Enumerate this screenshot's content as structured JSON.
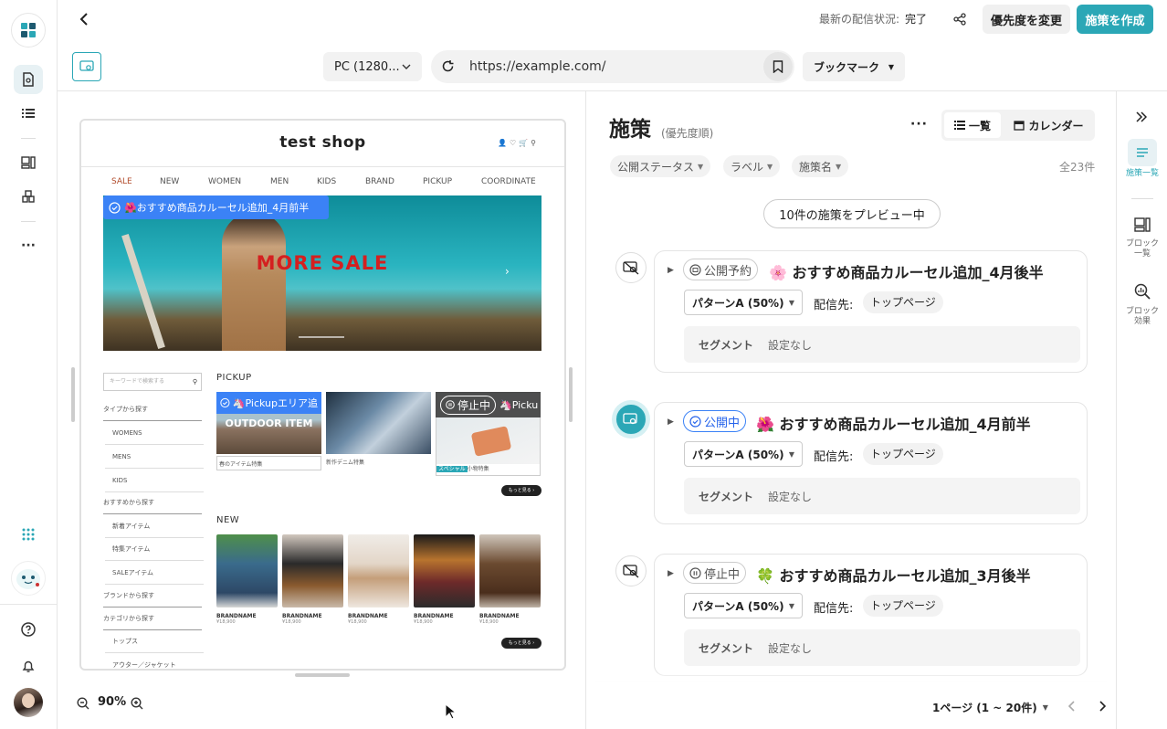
{
  "header": {
    "status_label": "最新の配信状況:",
    "status_value": "完了",
    "priority_button": "優先度を変更",
    "create_button": "施策を作成"
  },
  "toolbar": {
    "device": "PC (1280...",
    "url": "https://example.com/",
    "bookmark_button": "ブックマーク"
  },
  "preview": {
    "shop_title": "test shop",
    "nav": [
      "SALE",
      "NEW",
      "WOMEN",
      "MEN",
      "KIDS",
      "BRAND",
      "PICKUP",
      "COORDINATE"
    ],
    "overlay_label": "🌺おすすめ商品カルーセル追加_4月前半",
    "banner_text": "MORE SALE",
    "search_placeholder": "キーワードで検索する",
    "sidebar": [
      "タイプから探す",
      "WOMENS",
      "MENS",
      "KIDS",
      "おすすめから探す",
      "新着アイテム",
      "特集アイテム",
      "SALEアイテム",
      "ブランドから探す",
      "カテゴリから探す",
      "トップス",
      "アウター／ジャケット"
    ],
    "pickup_heading": "PICKUP",
    "pickup_overlay": "🦄Pickupエリア追",
    "pickup_stop": "停止中",
    "pickup_stop2": "🦄Picku",
    "pickup_items": [
      "OUTDOOR ITEM",
      "春のアイテム特集",
      "新作デニム特集",
      "小物特集"
    ],
    "special_badge": "スペシャル",
    "more_label": "もっと見る",
    "new_heading": "NEW",
    "new_products": [
      {
        "name": "BRANDNAME",
        "price": "¥18,900"
      },
      {
        "name": "BRANDNAME",
        "price": "¥18,900"
      },
      {
        "name": "BRANDNAME",
        "price": "¥18,900"
      },
      {
        "name": "BRANDNAME",
        "price": "¥18,900"
      },
      {
        "name": "BRANDNAME",
        "price": "¥18,900"
      }
    ],
    "zoom": "90%"
  },
  "list": {
    "title": "施策",
    "subtitle": "(優先度順)",
    "view_list": "一覧",
    "view_calendar": "カレンダー",
    "filters": [
      "公開ステータス",
      "ラベル",
      "施策名"
    ],
    "total": "全23件",
    "preview_count": "10件の施策をプレビュー中",
    "pagination": "1ページ (1 ~ 20件)",
    "campaigns": [
      {
        "status": "公開予約",
        "emoji": "🌸",
        "title": "おすすめ商品カルーセル追加_4月後半",
        "pattern": "パターンA (50%)",
        "dest_label": "配信先:",
        "dest": "トップページ",
        "segment_label": "セグメント",
        "segment_value": "設定なし"
      },
      {
        "status": "公開中",
        "emoji": "🌺",
        "title": "おすすめ商品カルーセル追加_4月前半",
        "pattern": "パターンA (50%)",
        "dest_label": "配信先:",
        "dest": "トップページ",
        "segment_label": "セグメント",
        "segment_value": "設定なし"
      },
      {
        "status": "停止中",
        "emoji": "🍀",
        "title": "おすすめ商品カルーセル追加_3月後半",
        "pattern": "パターンA (50%)",
        "dest_label": "配信先:",
        "dest": "トップページ",
        "segment_label": "セグメント",
        "segment_value": "設定なし"
      }
    ]
  },
  "tools": {
    "campaign_list": "施策一覧",
    "block_list": [
      "ブロック",
      "一覧"
    ],
    "block_effect": [
      "ブロック",
      "効果"
    ]
  },
  "colors": {
    "accent": "#2ba7b6",
    "overlay_blue": "#3b82f6"
  }
}
